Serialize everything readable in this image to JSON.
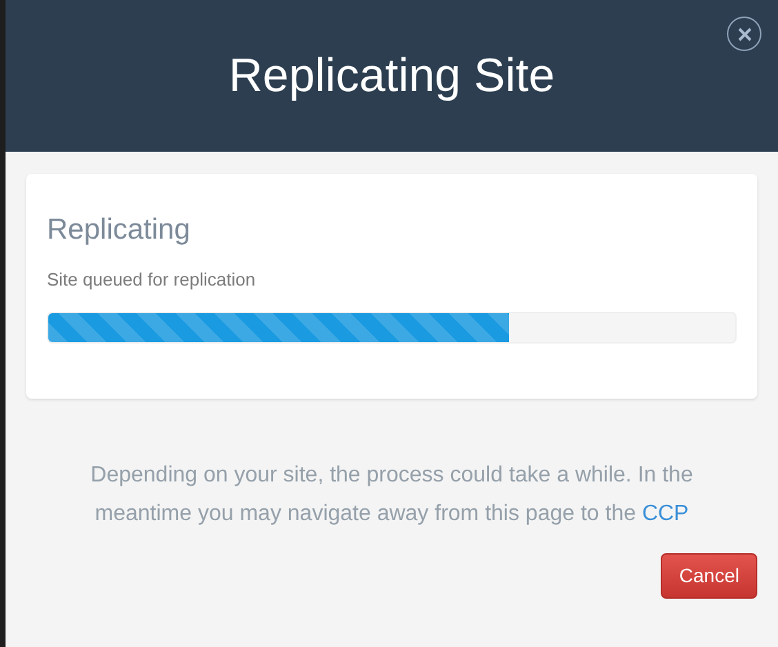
{
  "dialog": {
    "title": "Replicating Site"
  },
  "status": {
    "heading": "Replicating",
    "message": "Site queued for replication",
    "level": 0.67
  },
  "note": {
    "text": "Depending on your site, the process could take a while. In the meantime you may navigate away from this page to the",
    "link": "CCP"
  },
  "buttons": [
    "Cancel"
  ]
}
